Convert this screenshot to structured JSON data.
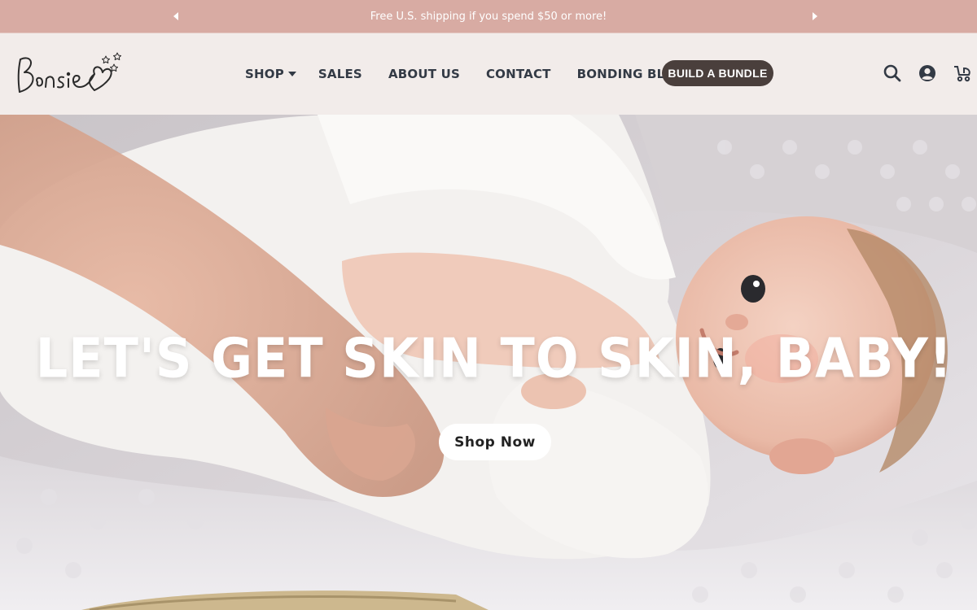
{
  "announcement": {
    "text": "Free U.S. shipping if you spend $50 or more!",
    "prev_icon": "caret-left-icon",
    "next_icon": "caret-right-icon"
  },
  "header": {
    "logo_text": "Bonsie",
    "nav": [
      {
        "label": "SHOP",
        "has_dropdown": true
      },
      {
        "label": "SALES"
      },
      {
        "label": "ABOUT US"
      },
      {
        "label": "CONTACT"
      },
      {
        "label": "BONDING BLOG"
      }
    ],
    "bundle_button": "BUILD A BUNDLE",
    "icons": [
      "search-icon",
      "account-icon",
      "cart-icon"
    ]
  },
  "hero": {
    "title": "LET'S GET SKIN TO SKIN, BABY!",
    "cta": "Shop Now"
  },
  "colors": {
    "announcement_bg": "#d8aba3",
    "header_bg": "#f2ecea",
    "nav_text": "#333a45",
    "bundle_bg": "#4a3f3c"
  }
}
